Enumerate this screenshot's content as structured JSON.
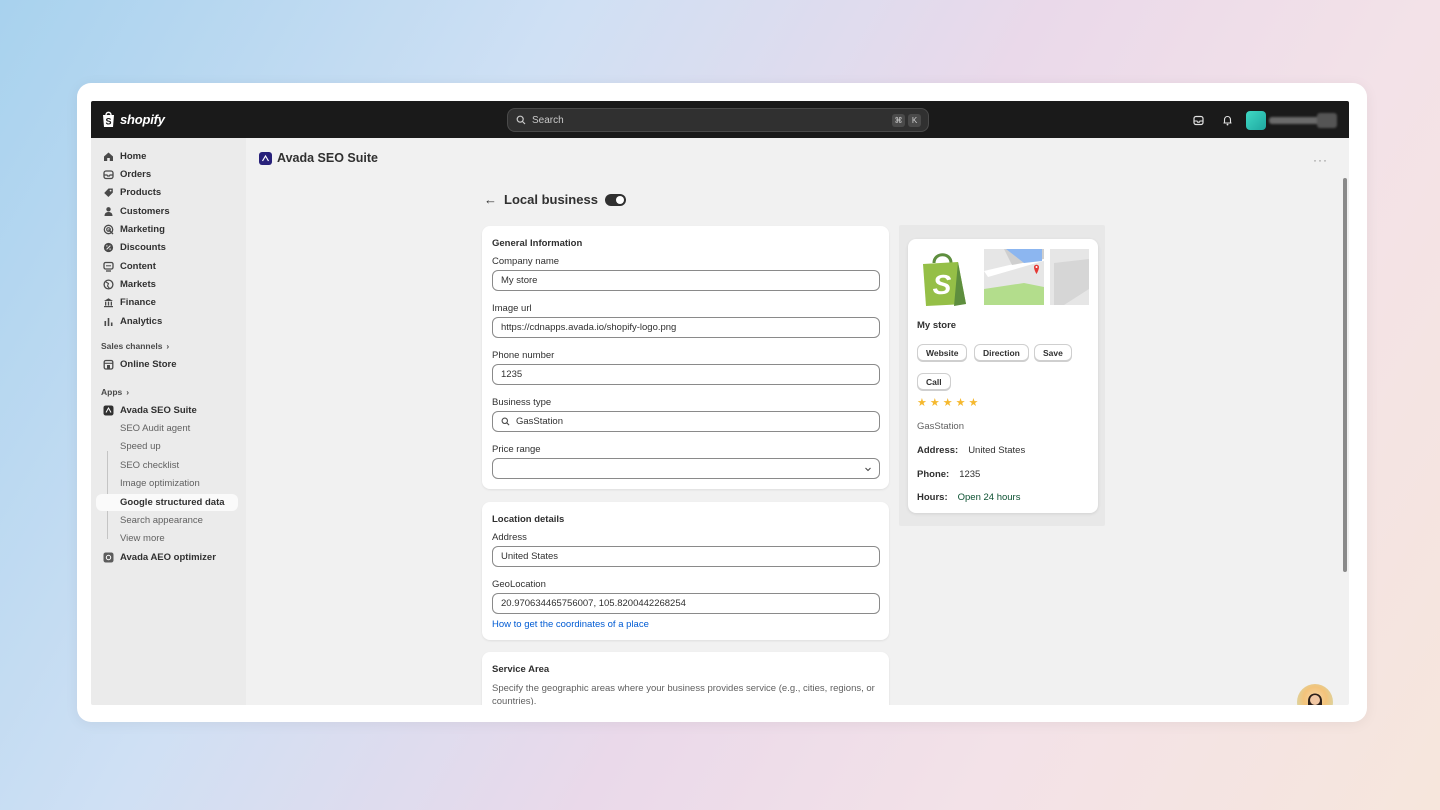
{
  "topbar": {
    "brand": "shopify",
    "search_placeholder": "Search",
    "kbd_cmd": "⌘",
    "kbd_k": "K"
  },
  "sidebar": {
    "items": [
      {
        "label": "Home",
        "icon": "home-icon"
      },
      {
        "label": "Orders",
        "icon": "orders-icon"
      },
      {
        "label": "Products",
        "icon": "tag-icon"
      },
      {
        "label": "Customers",
        "icon": "person-icon"
      },
      {
        "label": "Marketing",
        "icon": "target-icon"
      },
      {
        "label": "Discounts",
        "icon": "discount-icon"
      },
      {
        "label": "Content",
        "icon": "content-icon"
      },
      {
        "label": "Markets",
        "icon": "globe-icon"
      },
      {
        "label": "Finance",
        "icon": "bank-icon"
      },
      {
        "label": "Analytics",
        "icon": "chart-icon"
      }
    ],
    "sales_channels_label": "Sales channels",
    "online_store": "Online Store",
    "apps_label": "Apps",
    "chevron": "›",
    "avada_seo": "Avada SEO Suite",
    "sub_items": [
      "SEO Audit agent",
      "Speed up",
      "SEO checklist",
      "Image optimization",
      "Google structured data",
      "Search appearance",
      "View more"
    ],
    "active_sub": "Google structured data",
    "avada_aeo": "Avada AEO optimizer"
  },
  "header": {
    "app_title": "Avada SEO Suite",
    "more": "···"
  },
  "page": {
    "back": "←",
    "title": "Local business",
    "enabled": true
  },
  "general": {
    "title": "General Information",
    "company_label": "Company name",
    "company_value": "My store",
    "image_label": "Image url",
    "image_value": "https://cdnapps.avada.io/shopify-logo.png",
    "phone_label": "Phone number",
    "phone_value": "1235",
    "business_label": "Business type",
    "business_value": "GasStation",
    "price_label": "Price range",
    "price_value": ""
  },
  "location": {
    "title": "Location details",
    "address_label": "Address",
    "address_value": "United States",
    "geo_label": "GeoLocation",
    "geo_value": "20.970634465756007, 105.8200442268254",
    "help_link": "How to get the coordinates of a place"
  },
  "service": {
    "title": "Service Area",
    "help": "Specify the geographic areas where your business provides service (e.g., cities, regions, or countries)."
  },
  "preview": {
    "store_name": "My store",
    "buttons": [
      "Website",
      "Direction",
      "Save",
      "Call"
    ],
    "rating": 5,
    "business_type": "GasStation",
    "address_label": "Address:",
    "address_value": "United States",
    "phone_label": "Phone:",
    "phone_value": "1235",
    "hours_label": "Hours:",
    "hours_value": "Open 24 hours"
  },
  "colors": {
    "topbar": "#1a1a1a",
    "sidebar": "#ebebeb",
    "link": "#005bd3",
    "open": "#0c5132",
    "star": "#f5b82e",
    "shopify_green": "#5e8e3e"
  }
}
